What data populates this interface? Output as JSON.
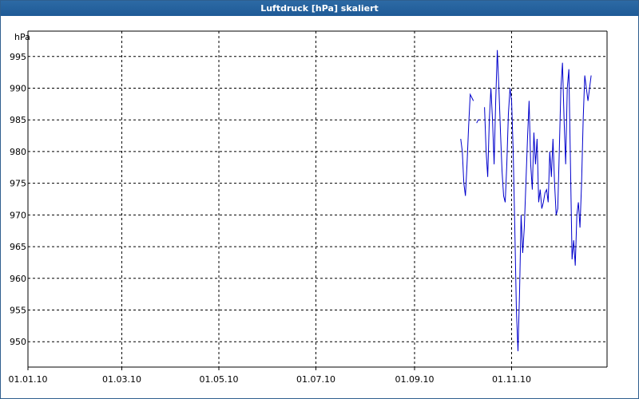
{
  "window": {
    "title": "Luftdruck [hPa] skaliert"
  },
  "chart_data": {
    "type": "line",
    "title": "Luftdruck [hPa] skaliert",
    "ylabel": "hPa",
    "xlabel": "",
    "xlim": [
      "2010-01-01",
      "2010-12-31"
    ],
    "ylim": [
      946,
      999
    ],
    "yticks": [
      950,
      955,
      960,
      965,
      970,
      975,
      980,
      985,
      990,
      995
    ],
    "xticks": [
      "2010-01-01",
      "2010-03-01",
      "2010-05-01",
      "2010-07-01",
      "2010-09-01",
      "2010-11-01"
    ],
    "xtick_labels": [
      "01.01.10",
      "01.03.10",
      "01.05.10",
      "01.07.10",
      "01.09.10",
      "01.11.10"
    ],
    "grid": true,
    "colors": {
      "series": "#0000cc",
      "titlebar": "#1e5a96"
    },
    "series": [
      {
        "segments": [
          [
            [
              "2010-09-30",
              982
            ],
            [
              "2010-10-01",
              980
            ],
            [
              "2010-10-02",
              975
            ],
            [
              "2010-10-03",
              973
            ],
            [
              "2010-10-04",
              978
            ],
            [
              "2010-10-05",
              984
            ],
            [
              "2010-10-06",
              989
            ],
            [
              "2010-10-07",
              988.5
            ],
            [
              "2010-10-08",
              988
            ]
          ],
          [
            [
              "2010-10-10",
              984.5
            ],
            [
              "2010-10-11",
              985
            ],
            [
              "2010-10-12",
              985
            ]
          ],
          [
            [
              "2010-10-15",
              987
            ],
            [
              "2010-10-16",
              980
            ],
            [
              "2010-10-17",
              976
            ],
            [
              "2010-10-18",
              985
            ],
            [
              "2010-10-19",
              990
            ],
            [
              "2010-10-20",
              985
            ],
            [
              "2010-10-21",
              978
            ],
            [
              "2010-10-22",
              988
            ],
            [
              "2010-10-23",
              996
            ],
            [
              "2010-10-24",
              990
            ],
            [
              "2010-10-25",
              983
            ],
            [
              "2010-10-26",
              977
            ],
            [
              "2010-10-27",
              973
            ],
            [
              "2010-10-28",
              972
            ],
            [
              "2010-10-29",
              978
            ],
            [
              "2010-10-30",
              986
            ],
            [
              "2010-10-31",
              990
            ],
            [
              "2010-11-01",
              988
            ],
            [
              "2010-11-02",
              980
            ],
            [
              "2010-11-03",
              968
            ],
            [
              "2010-11-04",
              955
            ],
            [
              "2010-11-05",
              948.5
            ],
            [
              "2010-11-06",
              958
            ],
            [
              "2010-11-07",
              970
            ],
            [
              "2010-11-08",
              964
            ],
            [
              "2010-11-09",
              968
            ],
            [
              "2010-11-10",
              975
            ],
            [
              "2010-11-11",
              982
            ],
            [
              "2010-11-12",
              988
            ],
            [
              "2010-11-13",
              978
            ],
            [
              "2010-11-14",
              974
            ],
            [
              "2010-11-15",
              983
            ],
            [
              "2010-11-16",
              978
            ],
            [
              "2010-11-17",
              982
            ],
            [
              "2010-11-18",
              972
            ],
            [
              "2010-11-19",
              974
            ],
            [
              "2010-11-20",
              971
            ],
            [
              "2010-11-21",
              972
            ],
            [
              "2010-11-22",
              973.5
            ],
            [
              "2010-11-23",
              974
            ],
            [
              "2010-11-24",
              972
            ],
            [
              "2010-11-25",
              980
            ],
            [
              "2010-11-26",
              976
            ],
            [
              "2010-11-27",
              982
            ],
            [
              "2010-11-28",
              975
            ],
            [
              "2010-11-29",
              970
            ],
            [
              "2010-11-30",
              971
            ],
            [
              "2010-12-01",
              980
            ],
            [
              "2010-12-02",
              990
            ],
            [
              "2010-12-03",
              994
            ],
            [
              "2010-12-04",
              985
            ],
            [
              "2010-12-05",
              978
            ],
            [
              "2010-12-06",
              990
            ],
            [
              "2010-12-07",
              993
            ],
            [
              "2010-12-08",
              978
            ],
            [
              "2010-12-09",
              963
            ],
            [
              "2010-12-10",
              966
            ],
            [
              "2010-12-11",
              962
            ],
            [
              "2010-12-12",
              970
            ],
            [
              "2010-12-13",
              972
            ],
            [
              "2010-12-14",
              968
            ],
            [
              "2010-12-15",
              975
            ],
            [
              "2010-12-16",
              985
            ],
            [
              "2010-12-17",
              992
            ],
            [
              "2010-12-18",
              990
            ],
            [
              "2010-12-19",
              988
            ],
            [
              "2010-12-20",
              990
            ],
            [
              "2010-12-21",
              992
            ]
          ]
        ]
      }
    ]
  }
}
